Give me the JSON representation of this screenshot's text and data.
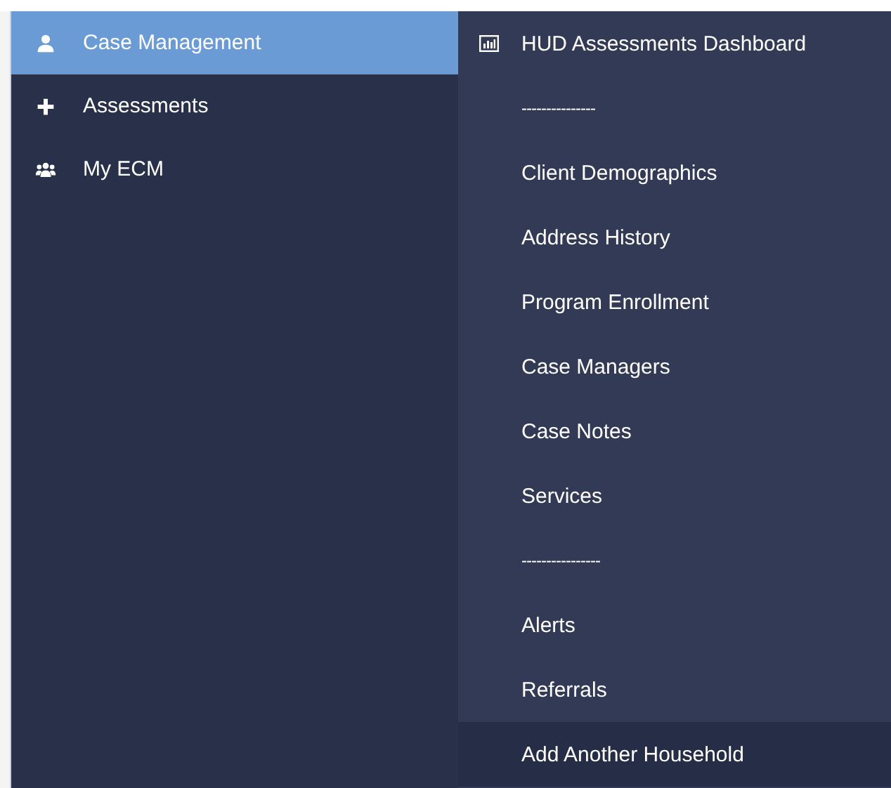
{
  "sidebar": {
    "items": [
      {
        "label": "Case Management",
        "selected": true
      },
      {
        "label": "Assessments",
        "selected": false
      },
      {
        "label": "My ECM",
        "selected": false
      }
    ]
  },
  "submenu": {
    "items": [
      {
        "kind": "chart-link",
        "label": "HUD Assessments Dashboard",
        "hovered": false
      },
      {
        "kind": "divider",
        "label": "---------------",
        "hovered": false
      },
      {
        "kind": "link",
        "label": "Client Demographics",
        "hovered": false
      },
      {
        "kind": "link",
        "label": "Address History",
        "hovered": false
      },
      {
        "kind": "link",
        "label": "Program Enrollment",
        "hovered": false
      },
      {
        "kind": "link",
        "label": "Case Managers",
        "hovered": false
      },
      {
        "kind": "link",
        "label": "Case Notes",
        "hovered": false
      },
      {
        "kind": "link",
        "label": "Services",
        "hovered": false
      },
      {
        "kind": "divider",
        "label": "----------------",
        "hovered": false
      },
      {
        "kind": "link",
        "label": "Alerts",
        "hovered": false
      },
      {
        "kind": "link",
        "label": "Referrals",
        "hovered": false
      },
      {
        "kind": "link",
        "label": "Add Another Household",
        "hovered": true
      }
    ]
  }
}
